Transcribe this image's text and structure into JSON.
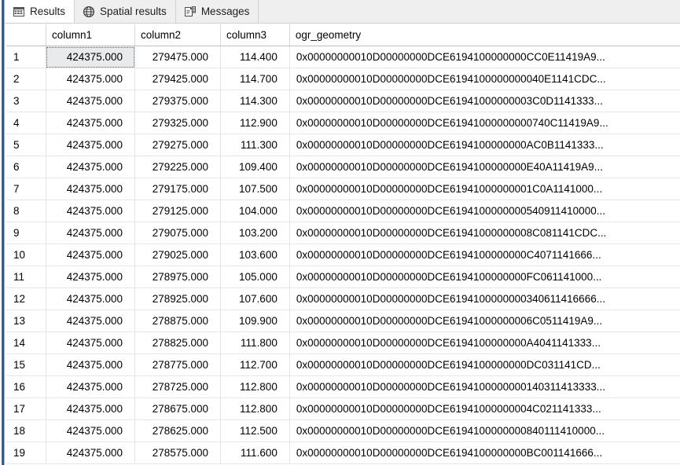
{
  "tabs": [
    {
      "label": "Results",
      "icon": "grid-icon",
      "active": true
    },
    {
      "label": "Spatial results",
      "icon": "globe-icon",
      "active": false
    },
    {
      "label": "Messages",
      "icon": "messages-icon",
      "active": false
    }
  ],
  "grid": {
    "row_number_header": "",
    "columns": [
      "column1",
      "column2",
      "column3",
      "ogr_geometry"
    ],
    "focused_cell": {
      "row": 1,
      "column": "column1"
    },
    "rows": [
      {
        "n": "1",
        "column1": "424375.000",
        "column2": "279475.000",
        "column3": "114.400",
        "ogr_geometry": "0x00000000010D00000000DCE6194100000000CC0E11419A9..."
      },
      {
        "n": "2",
        "column1": "424375.000",
        "column2": "279425.000",
        "column3": "114.700",
        "ogr_geometry": "0x00000000010D00000000DCE6194100000000040E1141CDC..."
      },
      {
        "n": "3",
        "column1": "424375.000",
        "column2": "279375.000",
        "column3": "114.300",
        "ogr_geometry": "0x00000000010D00000000DCE61941000000003C0D1141333..."
      },
      {
        "n": "4",
        "column1": "424375.000",
        "column2": "279325.000",
        "column3": "112.900",
        "ogr_geometry": "0x00000000010D00000000DCE61941000000000740C11419A9..."
      },
      {
        "n": "5",
        "column1": "424375.000",
        "column2": "279275.000",
        "column3": "111.300",
        "ogr_geometry": "0x00000000010D00000000DCE6194100000000AC0B1141333..."
      },
      {
        "n": "6",
        "column1": "424375.000",
        "column2": "279225.000",
        "column3": "109.400",
        "ogr_geometry": "0x00000000010D00000000DCE6194100000000E40A11419A9..."
      },
      {
        "n": "7",
        "column1": "424375.000",
        "column2": "279175.000",
        "column3": "107.500",
        "ogr_geometry": "0x00000000010D00000000DCE61941000000001C0A1141000..."
      },
      {
        "n": "8",
        "column1": "424375.000",
        "column2": "279125.000",
        "column3": "104.000",
        "ogr_geometry": "0x00000000010D00000000DCE6194100000000540911410000..."
      },
      {
        "n": "9",
        "column1": "424375.000",
        "column2": "279075.000",
        "column3": "103.200",
        "ogr_geometry": "0x00000000010D00000000DCE61941000000008C081141CDC..."
      },
      {
        "n": "10",
        "column1": "424375.000",
        "column2": "279025.000",
        "column3": "103.600",
        "ogr_geometry": "0x00000000010D00000000DCE6194100000000C4071141666..."
      },
      {
        "n": "11",
        "column1": "424375.000",
        "column2": "278975.000",
        "column3": "105.000",
        "ogr_geometry": "0x00000000010D00000000DCE6194100000000FC061141000..."
      },
      {
        "n": "12",
        "column1": "424375.000",
        "column2": "278925.000",
        "column3": "107.600",
        "ogr_geometry": "0x00000000010D00000000DCE6194100000000340611416666..."
      },
      {
        "n": "13",
        "column1": "424375.000",
        "column2": "278875.000",
        "column3": "109.900",
        "ogr_geometry": "0x00000000010D00000000DCE61941000000006C0511419A9..."
      },
      {
        "n": "14",
        "column1": "424375.000",
        "column2": "278825.000",
        "column3": "111.800",
        "ogr_geometry": "0x00000000010D00000000DCE6194100000000A4041141333..."
      },
      {
        "n": "15",
        "column1": "424375.000",
        "column2": "278775.000",
        "column3": "112.700",
        "ogr_geometry": "0x00000000010D00000000DCE6194100000000DC031141CD..."
      },
      {
        "n": "16",
        "column1": "424375.000",
        "column2": "278725.000",
        "column3": "112.800",
        "ogr_geometry": "0x00000000010D00000000DCE6194100000000140311413333..."
      },
      {
        "n": "17",
        "column1": "424375.000",
        "column2": "278675.000",
        "column3": "112.800",
        "ogr_geometry": "0x00000000010D00000000DCE61941000000004C021141333..."
      },
      {
        "n": "18",
        "column1": "424375.000",
        "column2": "278625.000",
        "column3": "112.500",
        "ogr_geometry": "0x00000000010D00000000DCE6194100000000840111410000..."
      },
      {
        "n": "19",
        "column1": "424375.000",
        "column2": "278575.000",
        "column3": "111.600",
        "ogr_geometry": "0x00000000010D00000000DCE6194100000000BC001141666..."
      }
    ]
  }
}
